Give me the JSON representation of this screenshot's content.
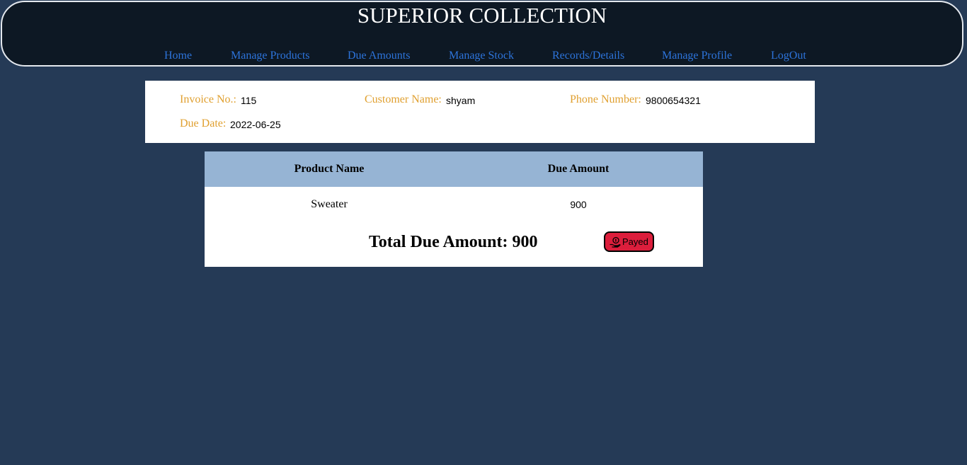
{
  "header": {
    "title": "SUPERIOR COLLECTION",
    "nav": [
      "Home",
      "Manage Products",
      "Due Amounts",
      "Manage Stock",
      "Records/Details",
      "Manage Profile",
      "LogOut"
    ]
  },
  "invoice": {
    "invoice_label": "Invoice No.:",
    "invoice_value": "115",
    "customer_label": "Customer Name:",
    "customer_value": "shyam",
    "phone_label": "Phone Number:",
    "phone_value": "9800654321",
    "due_date_label": "Due Date:",
    "due_date_value": "2022-06-25"
  },
  "table": {
    "columns": [
      "Product Name",
      "Due Amount"
    ],
    "rows": [
      [
        "Sweater",
        "900"
      ]
    ],
    "total_text": "Total Due Amount: 900",
    "payed_button": "Payed"
  },
  "icons": {
    "payed_button": "cash-hand-icon"
  },
  "colors": {
    "page_background": "#253a56",
    "header_background": "#0d1824",
    "nav_link": "#2d74db",
    "label_orange": "#e0a030",
    "table_header": "#96b4d4",
    "payed_button": "#dc1e3c"
  }
}
